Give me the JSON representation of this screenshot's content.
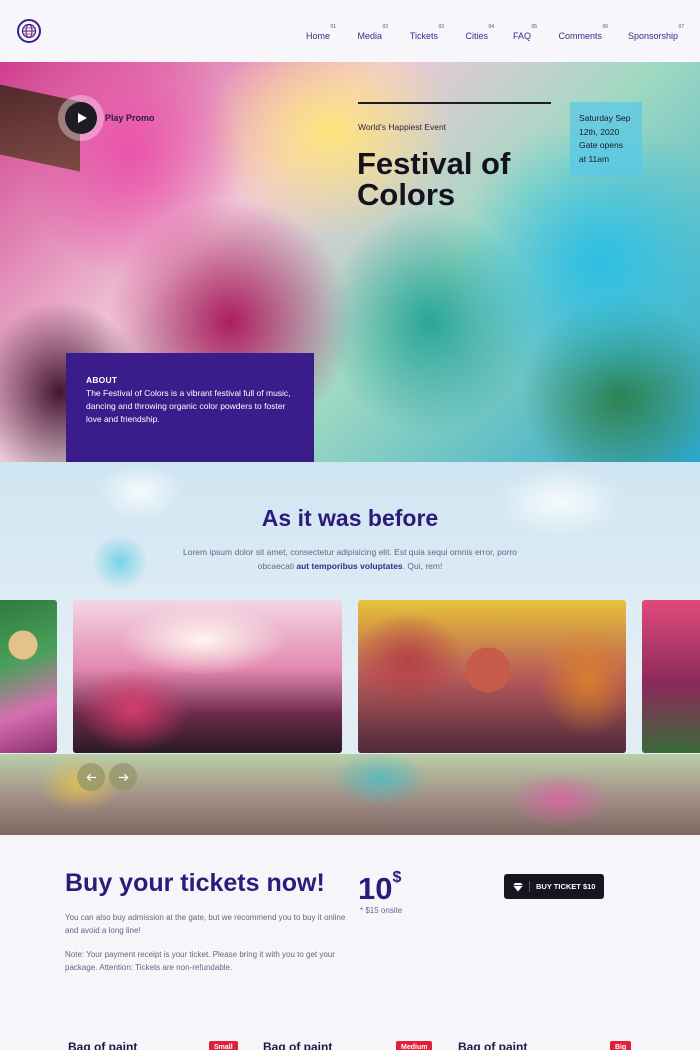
{
  "nav": {
    "items": [
      {
        "num": "01",
        "label": "Home"
      },
      {
        "num": "02",
        "label": "Media"
      },
      {
        "num": "03",
        "label": "Tickets"
      },
      {
        "num": "04",
        "label": "Cities"
      },
      {
        "num": "05",
        "label": "FAQ"
      },
      {
        "num": "06",
        "label": "Comments"
      },
      {
        "num": "07",
        "label": "Sponsorship"
      }
    ]
  },
  "hero": {
    "play_label": "Play Promo",
    "kicker": "World’s Happiest Event",
    "title_line1": "Festival of",
    "title_line2": "Colors",
    "date_line1": "Saturday Sep",
    "date_line2": "12th, 2020",
    "date_line3": "Gate opens",
    "date_line4": "at 11am",
    "about_title": "ABOUT",
    "about_text": "The Festival of Colors is a vibrant festival full of music, dancing and throwing organic color powders to foster love and friendship."
  },
  "gallery": {
    "title": "As it was before",
    "text_part1": "Lorem ipsum dolor sit amet, consectetur adipisicing elit. Est quia sequi omnis error, porro obcaecati ",
    "text_bold": "aut temporibus voluptates",
    "text_part2": ". Qui, rem!"
  },
  "tickets": {
    "title": "Buy your tickets now!",
    "text1": "You can also buy admission at the gate, but we recommend you to buy it online and avoid a long line!",
    "text2": "Note: Your payment receipt is your ticket. Please bring it with you to get your package. Attention: Tickets are non-refundable.",
    "price_value": "10",
    "price_currency": "$",
    "price_note": "* $15 onsite",
    "buy_label": "BUY TICKET $10"
  },
  "bags": [
    {
      "name": "Bag of paint",
      "size": "Small"
    },
    {
      "name": "Bag of paint",
      "size": "Medium"
    },
    {
      "name": "Bag of paint",
      "size": "Big"
    }
  ],
  "colors": {
    "brand_purple": "#3a1c8a",
    "heading_purple": "#2f1a7c",
    "button_dark": "#17151f",
    "badge_red": "#e0213a"
  }
}
